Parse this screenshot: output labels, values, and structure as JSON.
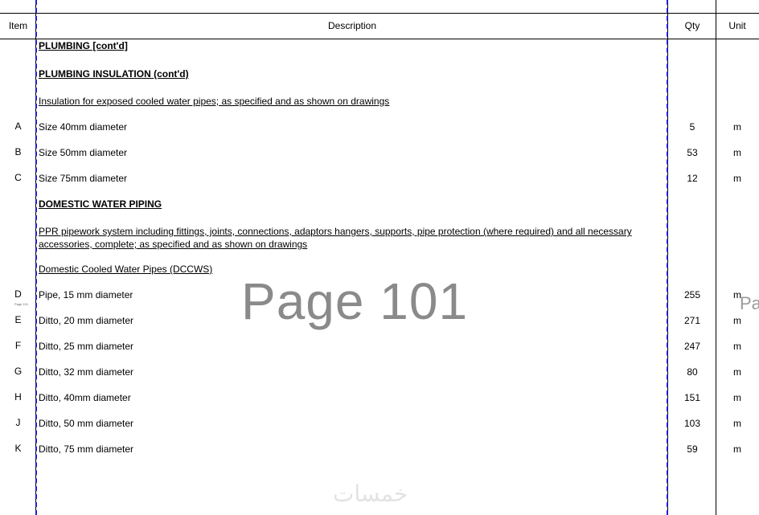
{
  "header": {
    "item": "Item",
    "description": "Description",
    "qty": "Qty",
    "unit": "Unit"
  },
  "sections": {
    "plumbing": "PLUMBING [cont'd]",
    "insulation": "PLUMBING INSULATION (cont'd)",
    "insulation_desc": "Insulation for exposed cooled water pipes; as specified and as shown on drawings",
    "domestic": "DOMESTIC WATER PIPING",
    "ppr_desc": "PPR pipework system including fittings, joints, connections, adaptors hangers, supports, pipe protection (where required) and all necessary accessories, complete; as specified and as shown on drawings",
    "dccws": "Domestic Cooled Water Pipes (DCCWS)"
  },
  "rows": [
    {
      "item": "A",
      "description": "Size 40mm diameter",
      "qty": "5",
      "unit": "m"
    },
    {
      "item": "B",
      "description": "Size 50mm diameter",
      "qty": "53",
      "unit": "m"
    },
    {
      "item": "C",
      "description": "Size 75mm diameter",
      "qty": "12",
      "unit": "m"
    },
    {
      "item": "D",
      "description": "Pipe, 15 mm diameter",
      "qty": "255",
      "unit": "m"
    },
    {
      "item": "E",
      "description": "Ditto, 20 mm diameter",
      "qty": "271",
      "unit": "m"
    },
    {
      "item": "F",
      "description": "Ditto, 25 mm diameter",
      "qty": "247",
      "unit": "m"
    },
    {
      "item": "G",
      "description": "Ditto, 32 mm diameter",
      "qty": "80",
      "unit": "m"
    },
    {
      "item": "H",
      "description": "Ditto, 40mm diameter",
      "qty": "151",
      "unit": "m"
    },
    {
      "item": "J",
      "description": "Ditto, 50 mm diameter",
      "qty": "103",
      "unit": "m"
    },
    {
      "item": "K",
      "description": "Ditto, 75 mm diameter",
      "qty": "59",
      "unit": "m"
    }
  ],
  "overlay": {
    "page_label": "Page 101",
    "page_label_partial": "Pa",
    "tiny_label": "Page 101",
    "logo": "خمسات"
  }
}
